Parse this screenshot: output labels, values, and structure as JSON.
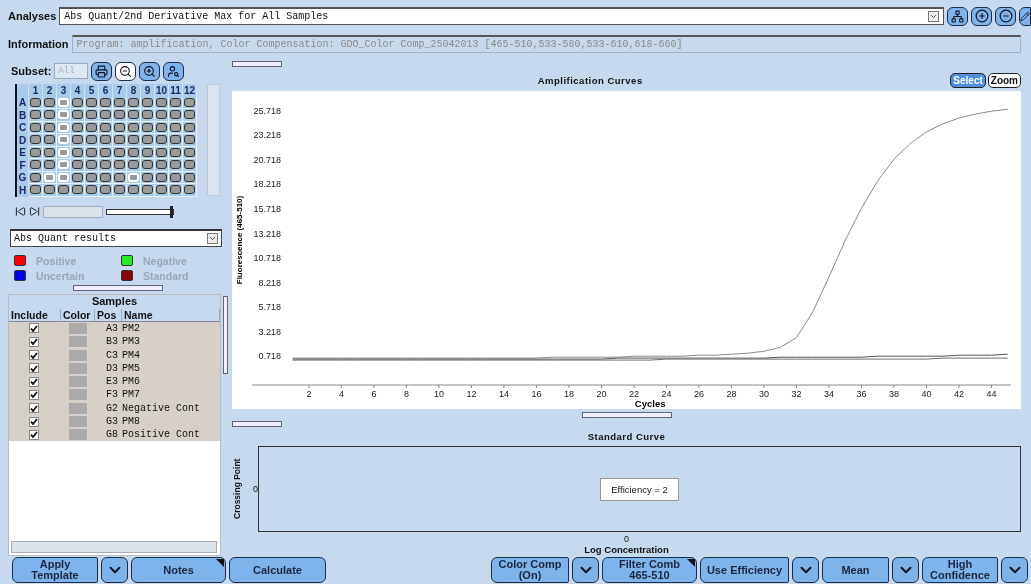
{
  "analyses": {
    "label": "Analyses",
    "value": "Abs Quant/2nd Derivative Max for All Samples"
  },
  "information": {
    "label": "Information",
    "value": "Program: amplification, Color Compensation: GDO_Color Comp_25042013 [465-510,533-580,533-610,618-660]",
    "disabled": true
  },
  "subset": {
    "label": "Subset:",
    "value": "All",
    "disabled": true
  },
  "plate": {
    "columns": [
      "1",
      "2",
      "3",
      "4",
      "5",
      "6",
      "7",
      "8",
      "9",
      "10",
      "11",
      "12"
    ],
    "rows": [
      {
        "label": "A",
        "wells": [
          {
            "selected": false
          },
          {
            "selected": false
          },
          {
            "selected": true
          },
          {
            "selected": false
          },
          {
            "selected": false
          },
          {
            "selected": false
          },
          {
            "selected": false
          },
          {
            "selected": false
          },
          {
            "selected": false
          },
          {
            "selected": false
          },
          {
            "selected": false
          },
          {
            "selected": false
          }
        ]
      },
      {
        "label": "B",
        "wells": [
          {
            "selected": false
          },
          {
            "selected": false
          },
          {
            "selected": true
          },
          {
            "selected": false
          },
          {
            "selected": false
          },
          {
            "selected": false
          },
          {
            "selected": false
          },
          {
            "selected": false
          },
          {
            "selected": false
          },
          {
            "selected": false
          },
          {
            "selected": false
          },
          {
            "selected": false
          }
        ]
      },
      {
        "label": "C",
        "wells": [
          {
            "selected": false
          },
          {
            "selected": false
          },
          {
            "selected": true
          },
          {
            "selected": false
          },
          {
            "selected": false
          },
          {
            "selected": false
          },
          {
            "selected": false
          },
          {
            "selected": false
          },
          {
            "selected": false
          },
          {
            "selected": false
          },
          {
            "selected": false
          },
          {
            "selected": false
          }
        ]
      },
      {
        "label": "D",
        "wells": [
          {
            "selected": false
          },
          {
            "selected": false
          },
          {
            "selected": true
          },
          {
            "selected": false
          },
          {
            "selected": false
          },
          {
            "selected": false
          },
          {
            "selected": false
          },
          {
            "selected": false
          },
          {
            "selected": false
          },
          {
            "selected": false
          },
          {
            "selected": false
          },
          {
            "selected": false
          }
        ]
      },
      {
        "label": "E",
        "wells": [
          {
            "selected": false
          },
          {
            "selected": false
          },
          {
            "selected": true
          },
          {
            "selected": false
          },
          {
            "selected": false
          },
          {
            "selected": false
          },
          {
            "selected": false
          },
          {
            "selected": false
          },
          {
            "selected": false
          },
          {
            "selected": false
          },
          {
            "selected": false
          },
          {
            "selected": false
          }
        ]
      },
      {
        "label": "F",
        "wells": [
          {
            "selected": false
          },
          {
            "selected": false
          },
          {
            "selected": true
          },
          {
            "selected": false
          },
          {
            "selected": false
          },
          {
            "selected": false
          },
          {
            "selected": false
          },
          {
            "selected": false
          },
          {
            "selected": false
          },
          {
            "selected": false
          },
          {
            "selected": false
          },
          {
            "selected": false
          }
        ]
      },
      {
        "label": "G",
        "wells": [
          {
            "selected": false
          },
          {
            "selected": true
          },
          {
            "selected": true
          },
          {
            "selected": false
          },
          {
            "selected": false
          },
          {
            "selected": false
          },
          {
            "selected": false
          },
          {
            "selected": true
          },
          {
            "selected": false
          },
          {
            "selected": false
          },
          {
            "selected": false
          },
          {
            "selected": false
          }
        ]
      },
      {
        "label": "H",
        "wells": [
          {
            "selected": false
          },
          {
            "selected": false
          },
          {
            "selected": false
          },
          {
            "selected": false
          },
          {
            "selected": false
          },
          {
            "selected": false
          },
          {
            "selected": false
          },
          {
            "selected": false
          },
          {
            "selected": false
          },
          {
            "selected": false
          },
          {
            "selected": false
          },
          {
            "selected": false
          }
        ]
      }
    ]
  },
  "plate_slider": {
    "level": 1
  },
  "results_dropdown": {
    "value": "Abs Quant results"
  },
  "legend": [
    {
      "label": "Positive",
      "color": "#ff0000"
    },
    {
      "label": "Negative",
      "color": "#22ee22"
    },
    {
      "label": "Uncertain",
      "color": "#0000ee"
    },
    {
      "label": "Standard",
      "color": "#8b0000"
    }
  ],
  "samples": {
    "title": "Samples",
    "columns": [
      "Include",
      "Color",
      "Pos",
      "Name"
    ],
    "rows": [
      {
        "checked": true,
        "pos": "A3",
        "name": "PM2"
      },
      {
        "checked": true,
        "pos": "B3",
        "name": "PM3"
      },
      {
        "checked": true,
        "pos": "C3",
        "name": "PM4"
      },
      {
        "checked": true,
        "pos": "D3",
        "name": "PM5"
      },
      {
        "checked": true,
        "pos": "E3",
        "name": "PM6"
      },
      {
        "checked": true,
        "pos": "F3",
        "name": "PM7"
      },
      {
        "checked": true,
        "pos": "G2",
        "name": "Negative Cont"
      },
      {
        "checked": true,
        "pos": "G3",
        "name": "PM8"
      },
      {
        "checked": true,
        "pos": "G8",
        "name": "Positive Cont"
      }
    ]
  },
  "amplification": {
    "title": "Amplification Curves",
    "modes": [
      {
        "label": "Select",
        "selected": true
      },
      {
        "label": "Zoom",
        "selected": false
      }
    ],
    "chart_data": {
      "type": "line",
      "xlabel": "Cycles",
      "ylabel": "Fluorescence (465-510)",
      "x": [
        1,
        2,
        3,
        4,
        5,
        6,
        7,
        8,
        9,
        10,
        11,
        12,
        13,
        14,
        15,
        16,
        17,
        18,
        19,
        20,
        21,
        22,
        23,
        24,
        25,
        26,
        27,
        28,
        29,
        30,
        31,
        32,
        33,
        34,
        35,
        36,
        37,
        38,
        39,
        40,
        41,
        42,
        43,
        44,
        45
      ],
      "series": [
        {
          "color": "#8a8a8a",
          "values": [
            0.5,
            0.5,
            0.5,
            0.5,
            0.5,
            0.5,
            0.5,
            0.5,
            0.5,
            0.5,
            0.5,
            0.5,
            0.5,
            0.5,
            0.5,
            0.5,
            0.6,
            0.6,
            0.6,
            0.6,
            0.6,
            0.7,
            0.7,
            0.7,
            0.7,
            0.8,
            0.8,
            0.9,
            1,
            1.2,
            1.6,
            2.6,
            5.2,
            8.8,
            12.5,
            15.8,
            18.6,
            20.8,
            22.4,
            23.6,
            24.4,
            25,
            25.4,
            25.7,
            25.9
          ]
        },
        {
          "color": "#555555",
          "values": [
            0.4,
            0.4,
            0.4,
            0.4,
            0.4,
            0.4,
            0.4,
            0.4,
            0.4,
            0.4,
            0.4,
            0.4,
            0.4,
            0.4,
            0.4,
            0.4,
            0.4,
            0.4,
            0.4,
            0.4,
            0.5,
            0.5,
            0.5,
            0.5,
            0.5,
            0.5,
            0.5,
            0.5,
            0.5,
            0.5,
            0.6,
            0.6,
            0.6,
            0.6,
            0.6,
            0.6,
            0.7,
            0.7,
            0.7,
            0.7,
            0.7,
            0.8,
            0.8,
            0.8,
            0.9
          ]
        },
        {
          "color": "#6e6e6e",
          "values": [
            0.3,
            0.3,
            0.3,
            0.3,
            0.3,
            0.3,
            0.3,
            0.3,
            0.3,
            0.3,
            0.3,
            0.3,
            0.3,
            0.3,
            0.3,
            0.3,
            0.3,
            0.3,
            0.3,
            0.3,
            0.3,
            0.3,
            0.3,
            0.4,
            0.4,
            0.4,
            0.4,
            0.4,
            0.4,
            0.4,
            0.4,
            0.4,
            0.4,
            0.4,
            0.4,
            0.4,
            0.4,
            0.4,
            0.4,
            0.4,
            0.5,
            0.5,
            0.5,
            0.5,
            0.5
          ]
        }
      ],
      "xlim": [
        -1.5,
        45.2
      ],
      "ylim": [
        -2.24,
        27.35
      ],
      "xticks": [
        2,
        4,
        6,
        8,
        10,
        12,
        14,
        16,
        18,
        20,
        22,
        24,
        26,
        28,
        30,
        32,
        34,
        36,
        38,
        40,
        42,
        44
      ],
      "yticks": [
        0.718,
        3.218,
        5.718,
        8.218,
        10.718,
        13.218,
        15.718,
        18.218,
        20.718,
        23.218,
        25.718
      ]
    }
  },
  "standard_curve": {
    "title": "Standard Curve",
    "ylabel": "Crossing Point",
    "ytick": "0",
    "xtick": "0",
    "xlabel": "Log Concentration",
    "note": "Efficiency = 2"
  },
  "buttons_left": [
    {
      "label": "Apply Template",
      "menu": true,
      "corner": false
    },
    {
      "label": "Notes",
      "menu": false,
      "corner": true
    },
    {
      "label": "Calculate",
      "menu": false,
      "corner": false
    }
  ],
  "buttons_right": [
    {
      "label": "Color Comp (On)",
      "menu": true,
      "corner": false
    },
    {
      "label": "Filter Comb 465-510",
      "menu": false,
      "corner": true
    },
    {
      "label": "Use Efficiency",
      "menu": true,
      "corner": false
    },
    {
      "label": "Mean",
      "menu": true,
      "corner": false
    },
    {
      "label": "High Confidence",
      "menu": true,
      "corner": false
    }
  ]
}
